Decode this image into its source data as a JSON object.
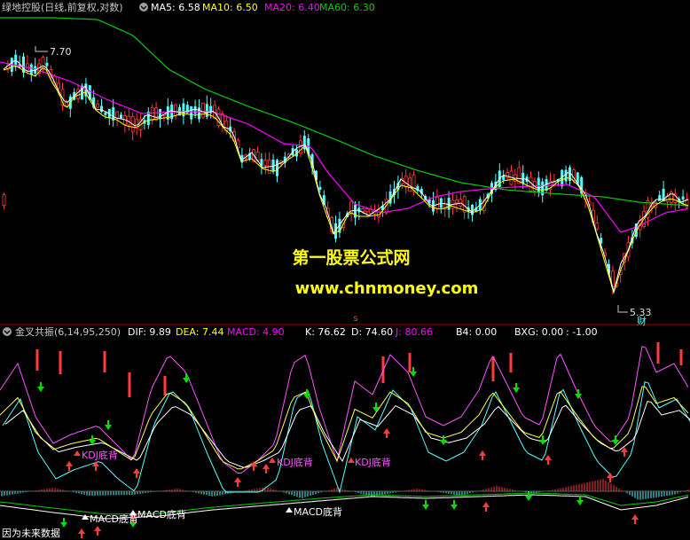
{
  "top_header": {
    "title": "绿地控股(日线,前复权,对数)",
    "ma5": "MA5: 6.58",
    "ma10": "MA10: 6.50",
    "ma20": "MA20: 6.40",
    "ma60": "MA60: 6.30"
  },
  "price_marks": {
    "high": "7.70",
    "low": "5.33",
    "low_note": "财"
  },
  "watermark": {
    "line1": "第一股票公式网",
    "line2": "www.chnmoney.com"
  },
  "separator_mark": "s",
  "bottom_header": {
    "title": "金叉共振(6,14,95,250)",
    "dif": "DIF: 9.89",
    "dea": "DEA: 7.44",
    "macd": "MACD: 4.90",
    "k": "K: 76.62",
    "d": "D: 74.60",
    "j": "J: 80.66",
    "b4": "B4: 0.00",
    "bxg": "BXG: 0.00",
    "extra": ": -1.00"
  },
  "signal_labels": {
    "kdj_divergence": "KDJ底背",
    "macd_divergence": "MACD底背"
  },
  "footer_text": "因为未来数据",
  "colors": {
    "up": "#ff3b3b",
    "down": "#54ffff",
    "ma5": "#ffffff",
    "ma10": "#ffff00",
    "ma20": "#ff00ff",
    "ma60": "#00d000",
    "watermark": "#ffff00",
    "macd_label": "#ff00ff",
    "k_line": "#ffff54",
    "d_line": "#ffffff",
    "j_line": "#ff54ff"
  },
  "chart_data": [
    {
      "type": "candlestick",
      "ma_series": [
        "MA5",
        "MA10",
        "MA20",
        "MA60"
      ],
      "ma_values": [
        6.58,
        6.5,
        6.4,
        6.3
      ],
      "annotated_high": 7.7,
      "annotated_low": 5.33
    },
    {
      "type": "line",
      "series_names": [
        "DIF",
        "DEA",
        "MACD",
        "K",
        "D",
        "J",
        "B4",
        "BXG"
      ],
      "values": [
        9.89,
        7.44,
        4.9,
        76.62,
        74.6,
        80.66,
        0.0,
        0.0
      ]
    }
  ]
}
